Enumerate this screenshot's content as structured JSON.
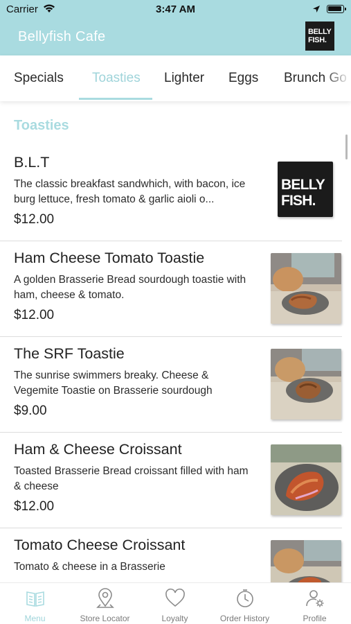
{
  "status_bar": {
    "carrier": "Carrier",
    "time": "3:47 AM",
    "icons": [
      "wifi-icon",
      "location-arrow-icon",
      "battery-icon"
    ]
  },
  "header": {
    "title": "Bellyfish Cafe",
    "logo_text_line1": "BELLY",
    "logo_text_line2": "FISH.",
    "background_color": "#a9dbe0"
  },
  "category_tabs": [
    {
      "label": "Specials",
      "active": false
    },
    {
      "label": "Toasties",
      "active": true
    },
    {
      "label": "Lighter",
      "active": false
    },
    {
      "label": "Eggs",
      "active": false
    },
    {
      "label": "Brunch Go",
      "active": false
    }
  ],
  "section": {
    "title": "Toasties",
    "accent_color": "#a9dbe0"
  },
  "menu_items": [
    {
      "name": "B.L.T",
      "description": "The classic breakfast sandwhich, with bacon, ice burg lettuce, fresh tomato & garlic aioli o...",
      "price": "$12.00",
      "image": "bellyfish-logo",
      "logo_line1": "BELLY",
      "logo_line2": "FISH."
    },
    {
      "name": "Ham Cheese Tomato Toastie",
      "description": "A golden Brasserie Bread sourdough toastie with ham, cheese & tomato.",
      "price": "$12.00",
      "image": "toastie-photo"
    },
    {
      "name": "The SRF Toastie",
      "description": "The sunrise swimmers breaky. Cheese & Vegemite Toastie on Brasserie sourdough",
      "price": "$9.00",
      "image": "toastie-photo"
    },
    {
      "name": "Ham & Cheese Croissant",
      "description": "Toasted Brasserie Bread croissant filled with ham & cheese",
      "price": "$12.00",
      "image": "croissant-photo"
    },
    {
      "name": "Tomato Cheese Croissant",
      "description": "Tomato & cheese in a Brasserie",
      "price": "",
      "image": "croissant-photo"
    }
  ],
  "bottom_nav": [
    {
      "label": "Menu",
      "icon": "menu-book-icon",
      "active": true
    },
    {
      "label": "Store Locator",
      "icon": "map-pin-icon",
      "active": false
    },
    {
      "label": "Loyalty",
      "icon": "heart-icon",
      "active": false
    },
    {
      "label": "Order History",
      "icon": "clock-icon",
      "active": false
    },
    {
      "label": "Profile",
      "icon": "profile-gear-icon",
      "active": false
    }
  ]
}
